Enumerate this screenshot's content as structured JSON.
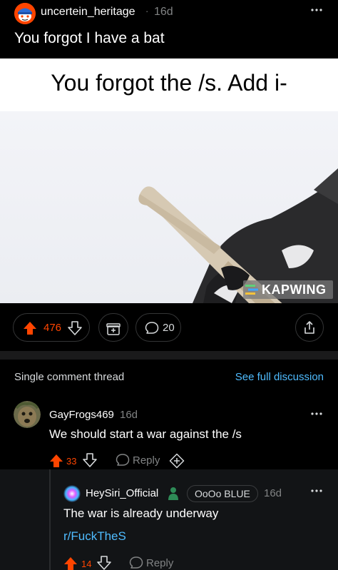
{
  "post": {
    "username": "uncertein_heritage",
    "separator": "·",
    "age": "16d",
    "title": "You forgot I have a bat",
    "media_caption": "You forgot the /s. Add i-",
    "watermark": "KAPWING",
    "score": "476",
    "comment_count": "20"
  },
  "thread": {
    "label": "Single comment thread",
    "see_full": "See full discussion"
  },
  "comments": [
    {
      "username": "GayFrogs469",
      "age": "16d",
      "body": "We should start a war against the /s",
      "score": "33",
      "reply_label": "Reply"
    },
    {
      "username": "HeySiri_Official",
      "flair": "OoOo BLUE",
      "age": "16d",
      "body": "The war is already underway",
      "link": "r/FuckTheS",
      "score": "14",
      "reply_label": "Reply"
    }
  ],
  "colors": {
    "upvote": "#ff4500",
    "link": "#4fbcff",
    "background": "#000000",
    "nested_background": "#121416",
    "muted": "#818384"
  },
  "icons": [
    "snoo-avatar-icon",
    "more-options-icon",
    "upvote-icon",
    "downvote-icon",
    "award-icon",
    "comment-icon",
    "share-icon",
    "reply-icon",
    "kapwing-logo-icon",
    "person-flair-icon"
  ]
}
